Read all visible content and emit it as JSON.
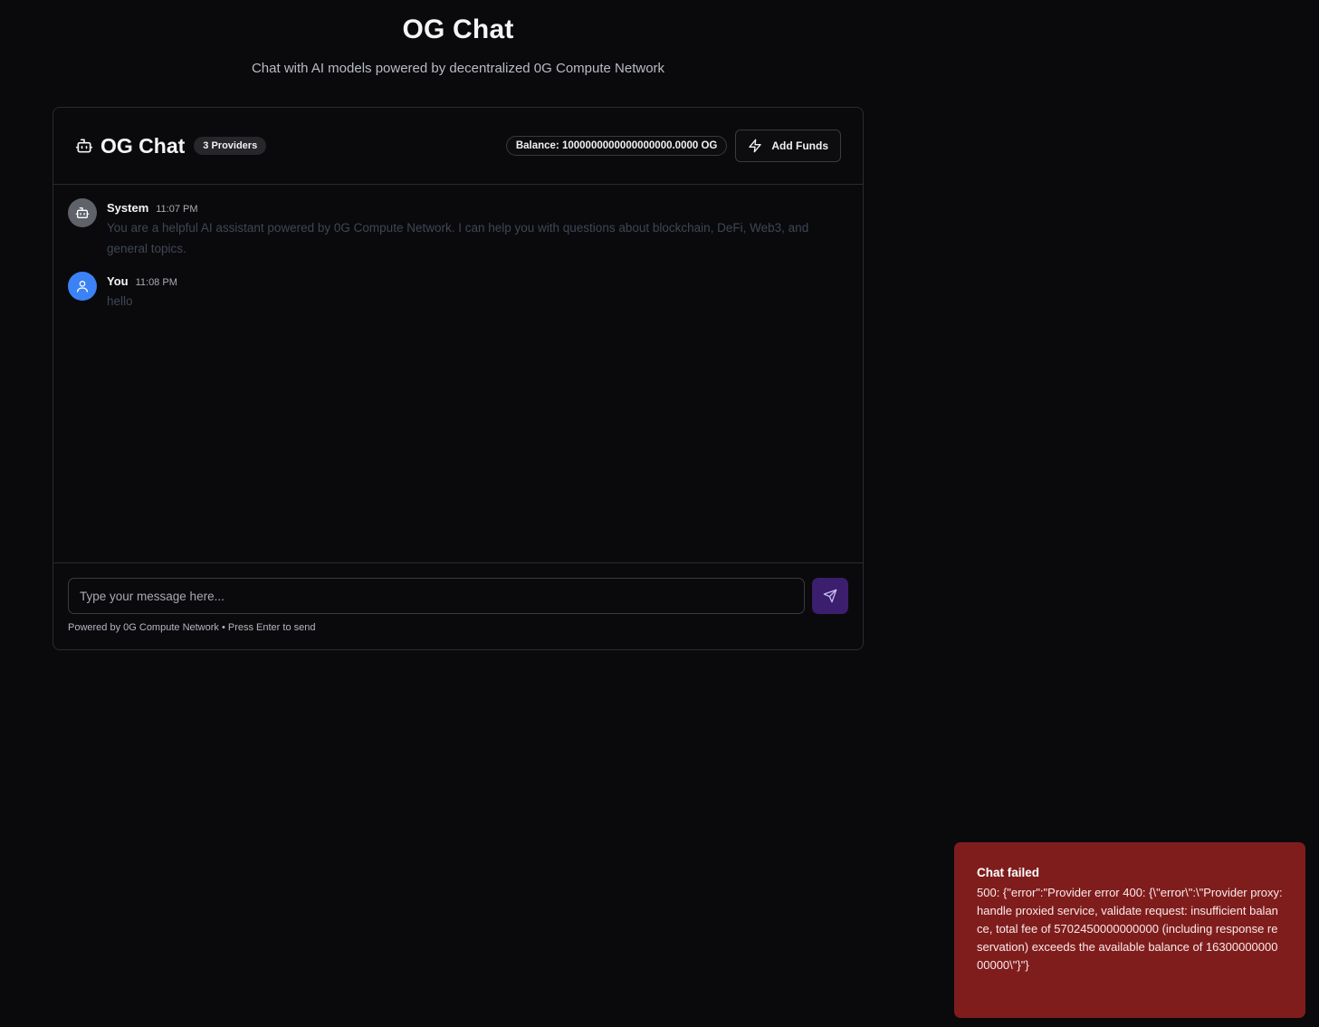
{
  "page": {
    "title": "OG Chat",
    "subtitle": "Chat with AI models powered by decentralized 0G Compute Network"
  },
  "card": {
    "title": "OG Chat",
    "providers_badge": "3 Providers",
    "balance": "Balance: 1000000000000000000.0000 OG",
    "add_funds_label": "Add Funds"
  },
  "messages": [
    {
      "sender": "System",
      "time": "11:07 PM",
      "text": "You are a helpful AI assistant powered by 0G Compute Network. I can help you with questions about blockchain, DeFi, Web3, and general topics.",
      "icon": "bot-icon"
    },
    {
      "sender": "You",
      "time": "11:08 PM",
      "text": "hello",
      "icon": "user-icon"
    }
  ],
  "composer": {
    "placeholder": "Type your message here...",
    "value": "",
    "send_icon": "send-icon",
    "footer_note": "Powered by 0G Compute Network • Press Enter to send"
  },
  "toast": {
    "title": "Chat failed",
    "message": "500: {\"error\":\"Provider error 400: {\\\"error\\\":\\\"Provider proxy: handle proxied service, validate request: insufficient balance, total fee of 5702450000000000 (including response reservation) exceeds the available balance of 1630000000000000\\\"}\"}"
  },
  "colors": {
    "background": "#0a0a0c",
    "send_button": "#3b1e6e",
    "user_avatar": "#3b82f6",
    "toast_bg": "#7f1d1d"
  }
}
